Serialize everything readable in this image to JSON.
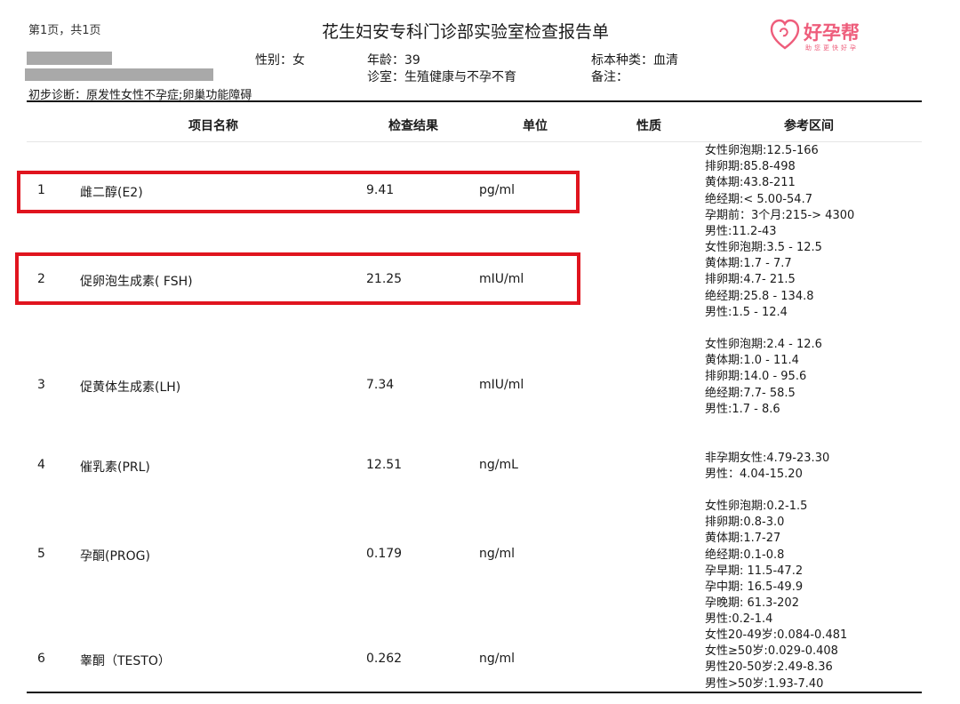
{
  "header": {
    "page_info": "第1页，共1页",
    "title": "花生妇安专科门诊部实验室检查报告单",
    "logo_text": "好孕帮",
    "logo_sub": "助您更快好孕",
    "logo_color": "#ee5d7b"
  },
  "patient": {
    "gender": "性别：女",
    "age": "年龄：39",
    "clinic": "诊室：生殖健康与不孕不育",
    "specimen": "标本种类：血清",
    "remark": "备注：",
    "diagnosis": "初步诊断：原发性女性不孕症;卵巢功能障碍"
  },
  "table": {
    "headers": [
      "项目名称",
      "检查结果",
      "单位",
      "性质",
      "参考区间"
    ],
    "rows": [
      {
        "no": "1",
        "name": "雌二醇(E2)",
        "result": "9.41",
        "unit": "pg/ml",
        "nature": "",
        "highlighted": true,
        "ref": [
          "女性卵泡期:12.5-166",
          "排卵期:85.8-498",
          "黄体期:43.8-211",
          "绝经期:< 5.00-54.7",
          "孕期前：3个月:215-> 4300",
          "男性:11.2-43"
        ]
      },
      {
        "no": "2",
        "name": "促卵泡生成素( FSH)",
        "result": "21.25",
        "unit": "mIU/ml",
        "nature": "",
        "highlighted": true,
        "ref": [
          "女性卵泡期:3.5 - 12.5",
          "黄体期:1.7 - 7.7",
          "排卵期:4.7- 21.5",
          "绝经期:25.8 - 134.8",
          "男性:1.5 - 12.4"
        ]
      },
      {
        "no": "3",
        "name": "促黄体生成素(LH)",
        "result": "7.34",
        "unit": "mIU/ml",
        "nature": "",
        "highlighted": false,
        "ref": [
          "女性卵泡期:2.4 - 12.6",
          "黄体期:1.0 - 11.4",
          "排卵期:14.0 - 95.6",
          "绝经期:7.7- 58.5",
          "男性:1.7 - 8.6"
        ]
      },
      {
        "no": "4",
        "name": "催乳素(PRL)",
        "result": "12.51",
        "unit": "ng/mL",
        "nature": "",
        "highlighted": false,
        "ref": [
          "非孕期女性:4.79-23.30",
          "男性：4.04-15.20"
        ]
      },
      {
        "no": "5",
        "name": "孕酮(PROG)",
        "result": "0.179",
        "unit": "ng/ml",
        "nature": "",
        "highlighted": false,
        "ref": [
          "女性卵泡期:0.2-1.5",
          "排卵期:0.8-3.0",
          "黄体期:1.7-27",
          "绝经期:0.1-0.8",
          "孕早期: 11.5-47.2",
          "孕中期: 16.5-49.9",
          "孕晚期: 61.3-202",
          "男性:0.2-1.4"
        ]
      },
      {
        "no": "6",
        "name": "睾酮（TESTO）",
        "result": "0.262",
        "unit": "ng/ml",
        "nature": "",
        "highlighted": false,
        "ref": [
          "女性20-49岁:0.084-0.481",
          "女性≥50岁:0.029-0.408",
          "男性20-50岁:2.49-8.36",
          "男性>50岁:1.93-7.40"
        ]
      }
    ]
  },
  "colors": {
    "highlight": "#e0141e",
    "redaction": "#a9a9a9"
  }
}
